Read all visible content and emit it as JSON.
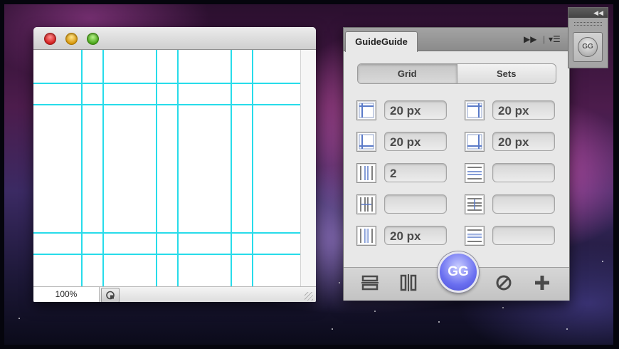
{
  "doc_window": {
    "zoom": "100%"
  },
  "panel": {
    "title": "GuideGuide",
    "tabs": [
      "Grid",
      "Sets"
    ],
    "fields": {
      "left_1": "20 px",
      "right_1": "20 px",
      "left_2": "20 px",
      "right_2": "20 px",
      "left_3": "2",
      "right_3": "",
      "left_4": "",
      "right_4": "",
      "left_5": "20 px",
      "right_5": ""
    },
    "gg_label": "GG"
  },
  "dock": {
    "gg_label": "GG"
  }
}
